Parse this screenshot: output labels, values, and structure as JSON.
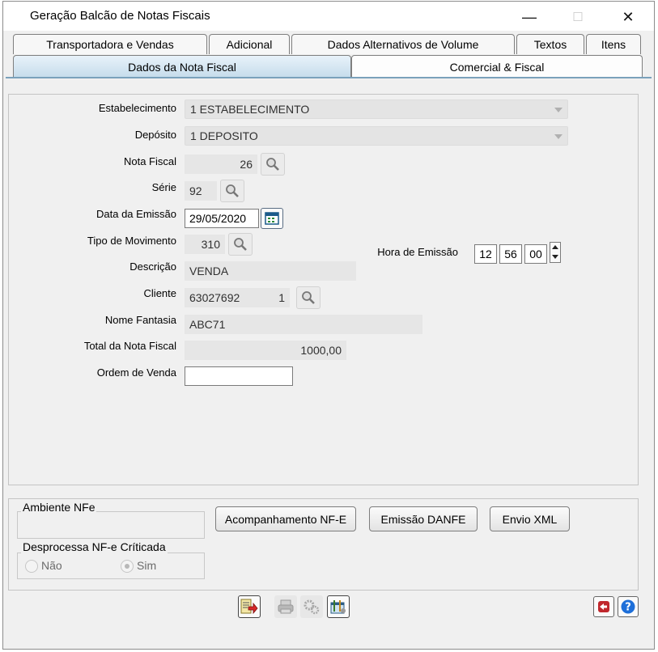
{
  "window": {
    "title": "Geração Balcão de Notas Fiscais",
    "minimize_glyph": "—",
    "maximize_glyph": "☐",
    "close_glyph": "✕"
  },
  "tabs": {
    "row1": [
      "Transportadora e Vendas",
      "Adicional",
      "Dados Alternativos de Volume",
      "Textos",
      "Itens"
    ],
    "row2": [
      "Dados da Nota Fiscal",
      "Comercial & Fiscal"
    ],
    "active": "Dados da Nota Fiscal"
  },
  "form": {
    "estabelecimento": {
      "label": "Estabelecimento",
      "value": "1 ESTABELECIMENTO"
    },
    "deposito": {
      "label": "Depósito",
      "value": "1 DEPOSITO"
    },
    "nota_fiscal": {
      "label": "Nota Fiscal",
      "value": "26"
    },
    "serie": {
      "label": "Série",
      "value": "92"
    },
    "data_emissao": {
      "label": "Data da Emissão",
      "value": "29/05/2020"
    },
    "tipo_movimento": {
      "label": "Tipo de Movimento",
      "value": "310"
    },
    "hora_emissao": {
      "label": "Hora de Emissão",
      "hour": "12",
      "minute": "56",
      "second": "00"
    },
    "descricao": {
      "label": "Descrição",
      "value": "VENDA"
    },
    "cliente": {
      "label": "Cliente",
      "code": "63027692",
      "seq": "1"
    },
    "nome_fantasia": {
      "label": "Nome Fantasia",
      "value": "ABC71"
    },
    "total_nota": {
      "label": "Total da Nota Fiscal",
      "value": "1000,00"
    },
    "ordem_venda": {
      "label": "Ordem de Venda",
      "value": ""
    }
  },
  "bottom": {
    "ambiente_title": "Ambiente NFe",
    "desprocessa_title": "Desprocessa NF-e Críticada",
    "radio_nao": "Não",
    "radio_sim": "Sim",
    "selected": "Sim",
    "btn_acompanhamento": "Acompanhamento NF-E",
    "btn_emissao_danfe": "Emissão DANFE",
    "btn_envio_xml": "Envio XML"
  },
  "icons": {
    "lookup": "magnifier-icon",
    "calendar": "calendar-icon",
    "toolbar": [
      "export-icon",
      "print-icon",
      "settings-gears-icon",
      "tools-icon"
    ],
    "exit": "exit-icon",
    "help": "help-icon"
  },
  "colors": {
    "accent_tab": "#c5dceb",
    "tab_line": "#7aa1bb",
    "help_blue": "#1e6fd9",
    "exit_red": "#c0282d"
  }
}
